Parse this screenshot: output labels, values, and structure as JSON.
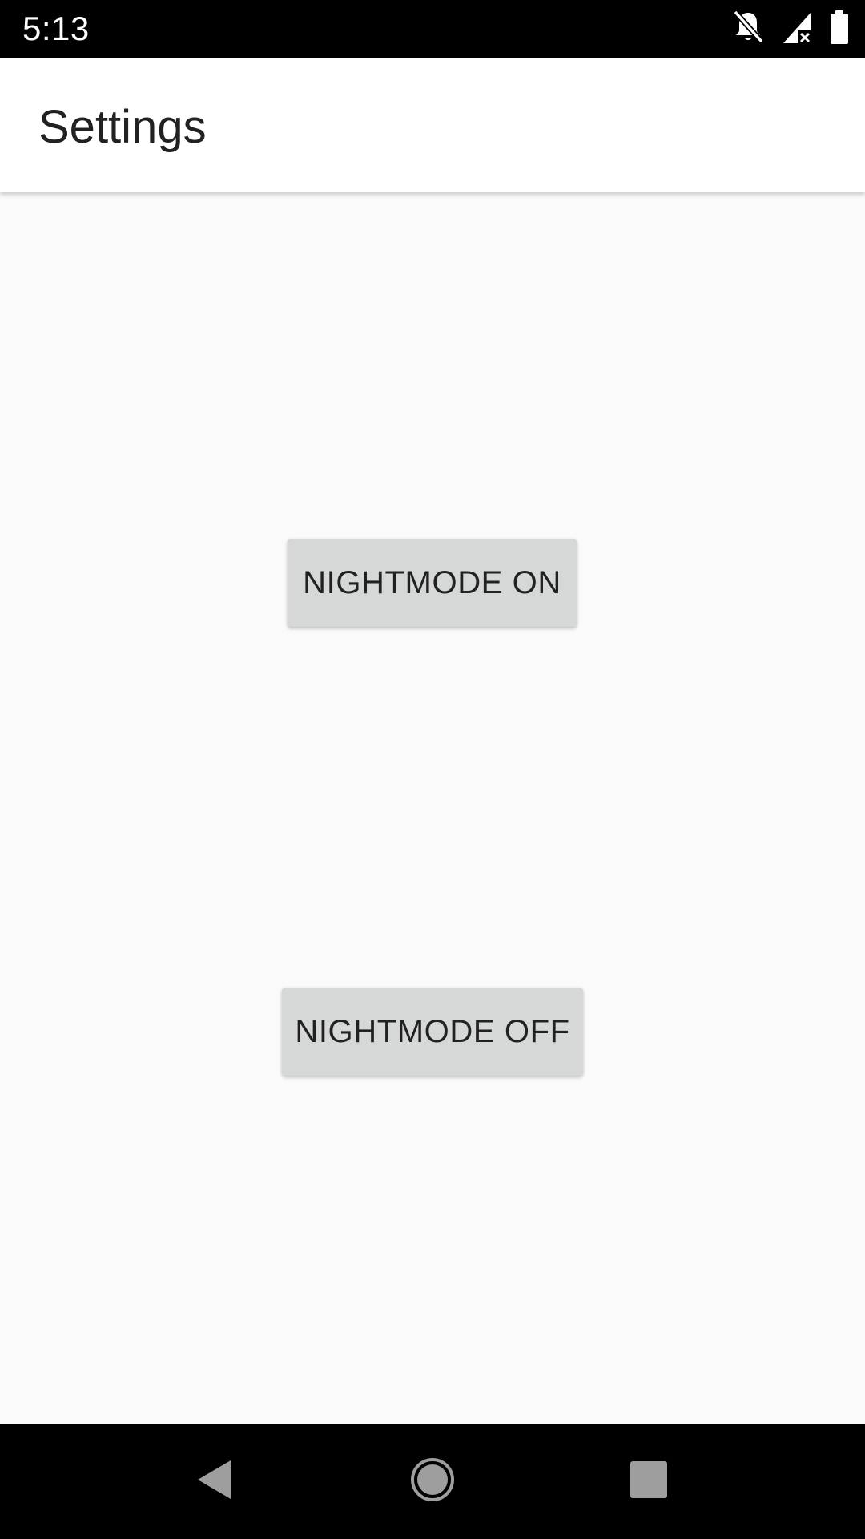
{
  "status_bar": {
    "time": "5:13",
    "icons": [
      "notifications-off-icon",
      "signal-no-data-icon",
      "battery-full-icon"
    ]
  },
  "app_bar": {
    "title": "Settings"
  },
  "main": {
    "buttons": [
      {
        "label": "NIGHTMODE ON"
      },
      {
        "label": "NIGHTMODE OFF"
      }
    ]
  },
  "nav_bar": {
    "icons": [
      "back-icon",
      "home-icon",
      "recents-icon"
    ]
  },
  "colors": {
    "status_bar_bg": "#000000",
    "app_bar_bg": "#ffffff",
    "content_bg": "#fafafa",
    "button_bg": "#d6d7d7",
    "text_primary": "#212121",
    "nav_icon": "#9e9e9e"
  }
}
